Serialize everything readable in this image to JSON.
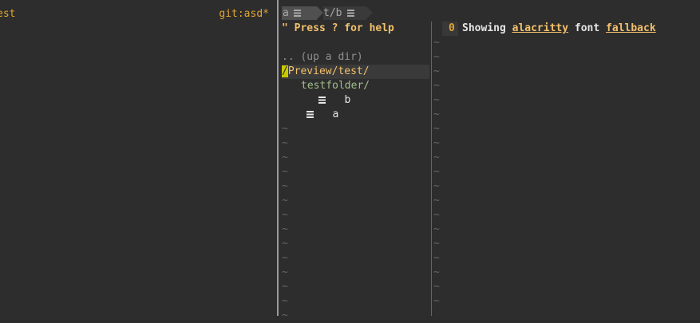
{
  "left": {
    "filename": "est",
    "git_status": "git:asd*"
  },
  "tabs": [
    {
      "label": "a",
      "icon": "file-icon"
    },
    {
      "label": "t/b",
      "icon": "file-icon"
    }
  ],
  "nerdtree": {
    "help": "\" Press ? for help",
    "updir": ".. (up a dir)",
    "root_cursor": "/",
    "root_rest": "Preview/test/",
    "folder": "testfolder/",
    "files": [
      {
        "name": "b"
      },
      {
        "name": "a"
      }
    ],
    "tilde": "~"
  },
  "editor": {
    "line_number": "0",
    "text_parts": [
      "Showing ",
      "alacritty",
      " font ",
      "fallback"
    ]
  },
  "colors": {
    "accent": "#e0a530",
    "highlight": "#f2c06b",
    "folder": "#a3be8c",
    "cursor": "#c8c800"
  }
}
